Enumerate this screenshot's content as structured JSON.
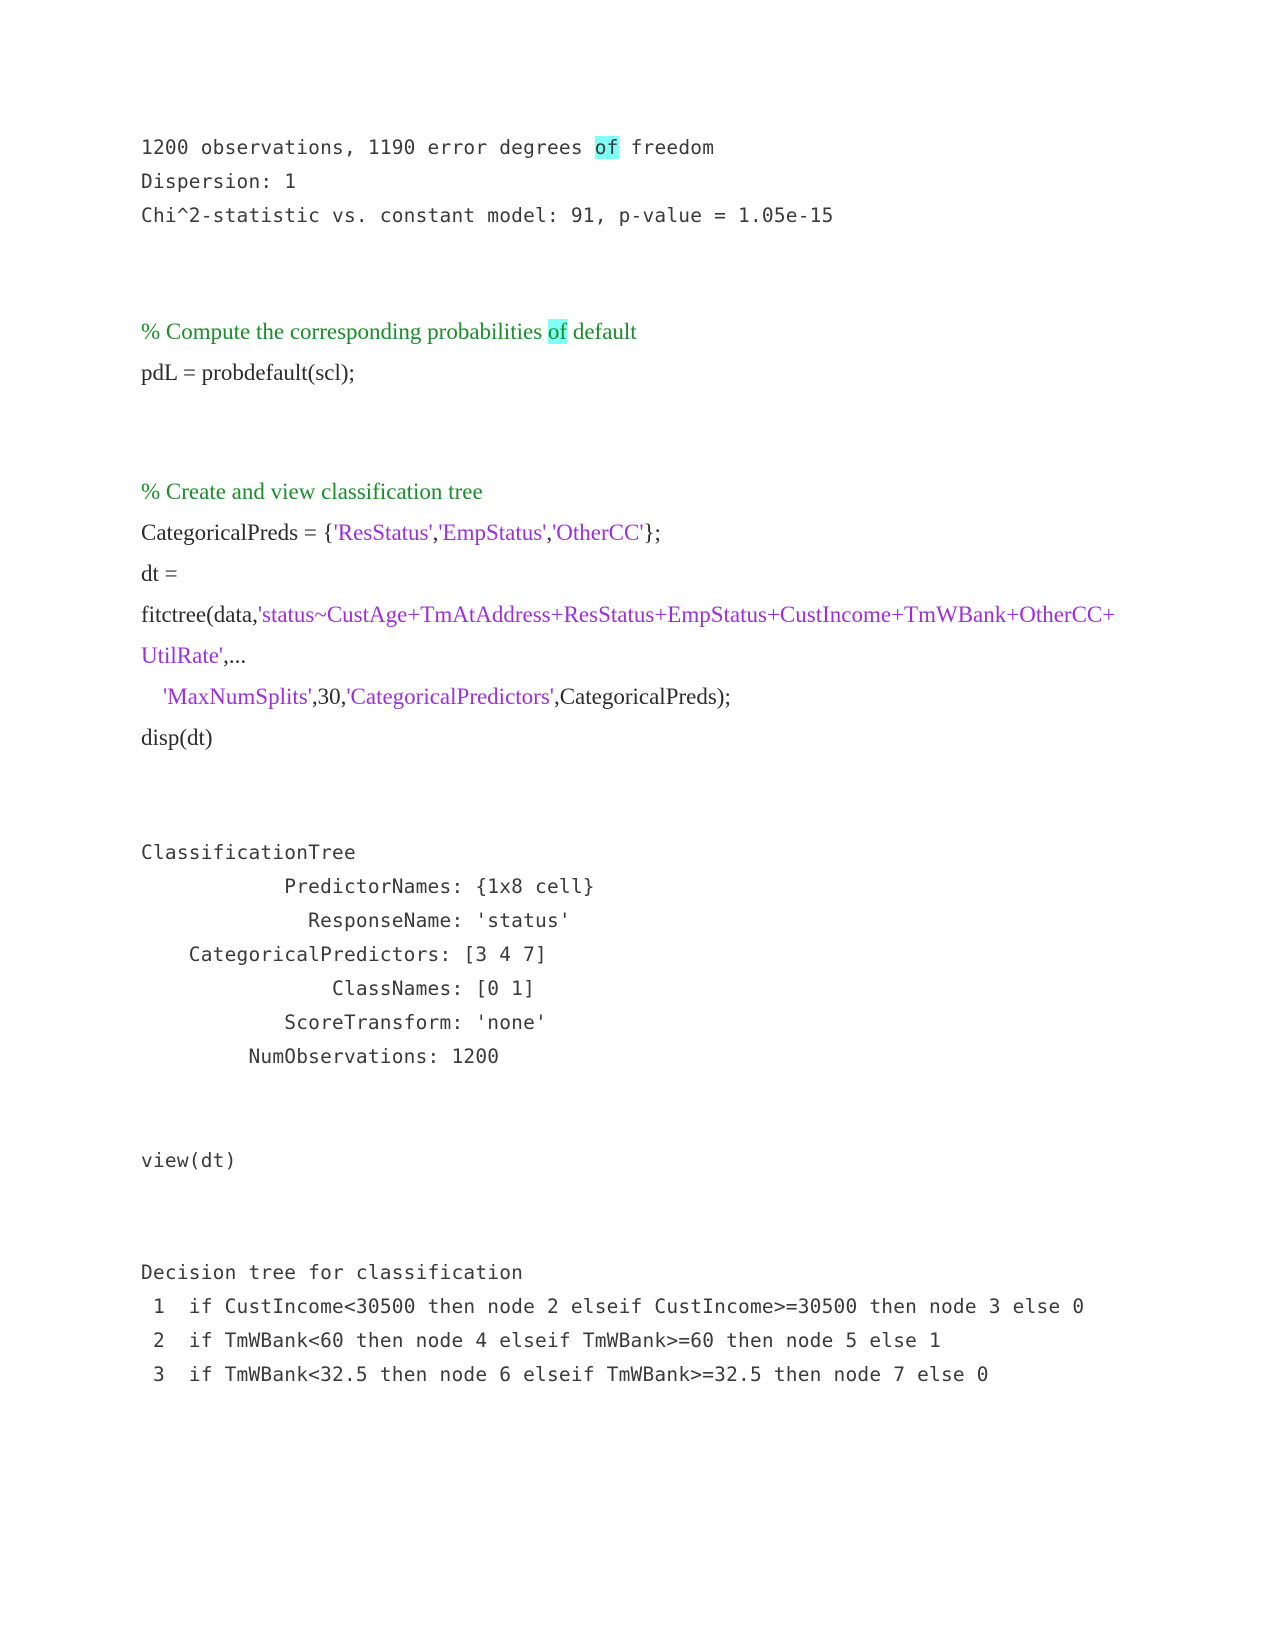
{
  "document": {
    "type": "matlab-live-script-output",
    "colors": {
      "comment_green": "#1a8c29",
      "string_purple": "#9b30d9",
      "highlight_cyan": "#7ffff5",
      "text": "#2b2b2b",
      "console_text": "#3a3a3a",
      "background": "#ffffff"
    }
  },
  "stats_output": {
    "line1_pre": "1200 observations, 1190 error degrees ",
    "line1_highlight": "of",
    "line1_post": " freedom",
    "line2": "Dispersion: 1",
    "line3": "Chi^2-statistic vs. constant model: 91, p-value = 1.05e-15"
  },
  "section_probdefault": {
    "comment_pre": "% Compute the corresponding probabilities ",
    "comment_highlight": "of",
    "comment_post": " default",
    "code": "pdL = probdefault(scl);"
  },
  "section_tree": {
    "comment": "% Create and view classification tree",
    "line_catpreds_pre": "CategoricalPreds = {",
    "line_catpreds_s1": "'ResStatus'",
    "line_catpreds_c1": ",",
    "line_catpreds_s2": "'EmpStatus'",
    "line_catpreds_c2": ",",
    "line_catpreds_s3": "'OtherCC'",
    "line_catpreds_post": "};",
    "line_dt": "dt =",
    "line_fitctree_pre": "fitctree(data,",
    "line_fitctree_formula": "'status~CustAge+TmAtAddress+ResStatus+EmpStatus+CustIncome+TmWBank+OtherCC+UtilRate'",
    "line_fitctree_post": ",...",
    "line_opts_s1": "'MaxNumSplits'",
    "line_opts_mid1": ",30,",
    "line_opts_s2": "'CategoricalPredictors'",
    "line_opts_post": ",CategoricalPreds);",
    "line_disp": "disp(dt)"
  },
  "tree_properties_output": {
    "header": "ClassificationTree",
    "rows": [
      "            PredictorNames: {1x8 cell}",
      "              ResponseName: 'status'",
      "    CategoricalPredictors: [3 4 7]",
      "                ClassNames: [0 1]",
      "            ScoreTransform: 'none'",
      "         NumObservations: 1200"
    ]
  },
  "section_view": {
    "code": "view(dt)"
  },
  "decision_tree_output": {
    "header": "Decision tree for classification",
    "lines": [
      " 1  if CustIncome<30500 then node 2 elseif CustIncome>=30500 then node 3 else 0",
      " 2  if TmWBank<60 then node 4 elseif TmWBank>=60 then node 5 else 1",
      " 3  if TmWBank<32.5 then node 6 elseif TmWBank>=32.5 then node 7 else 0"
    ]
  }
}
